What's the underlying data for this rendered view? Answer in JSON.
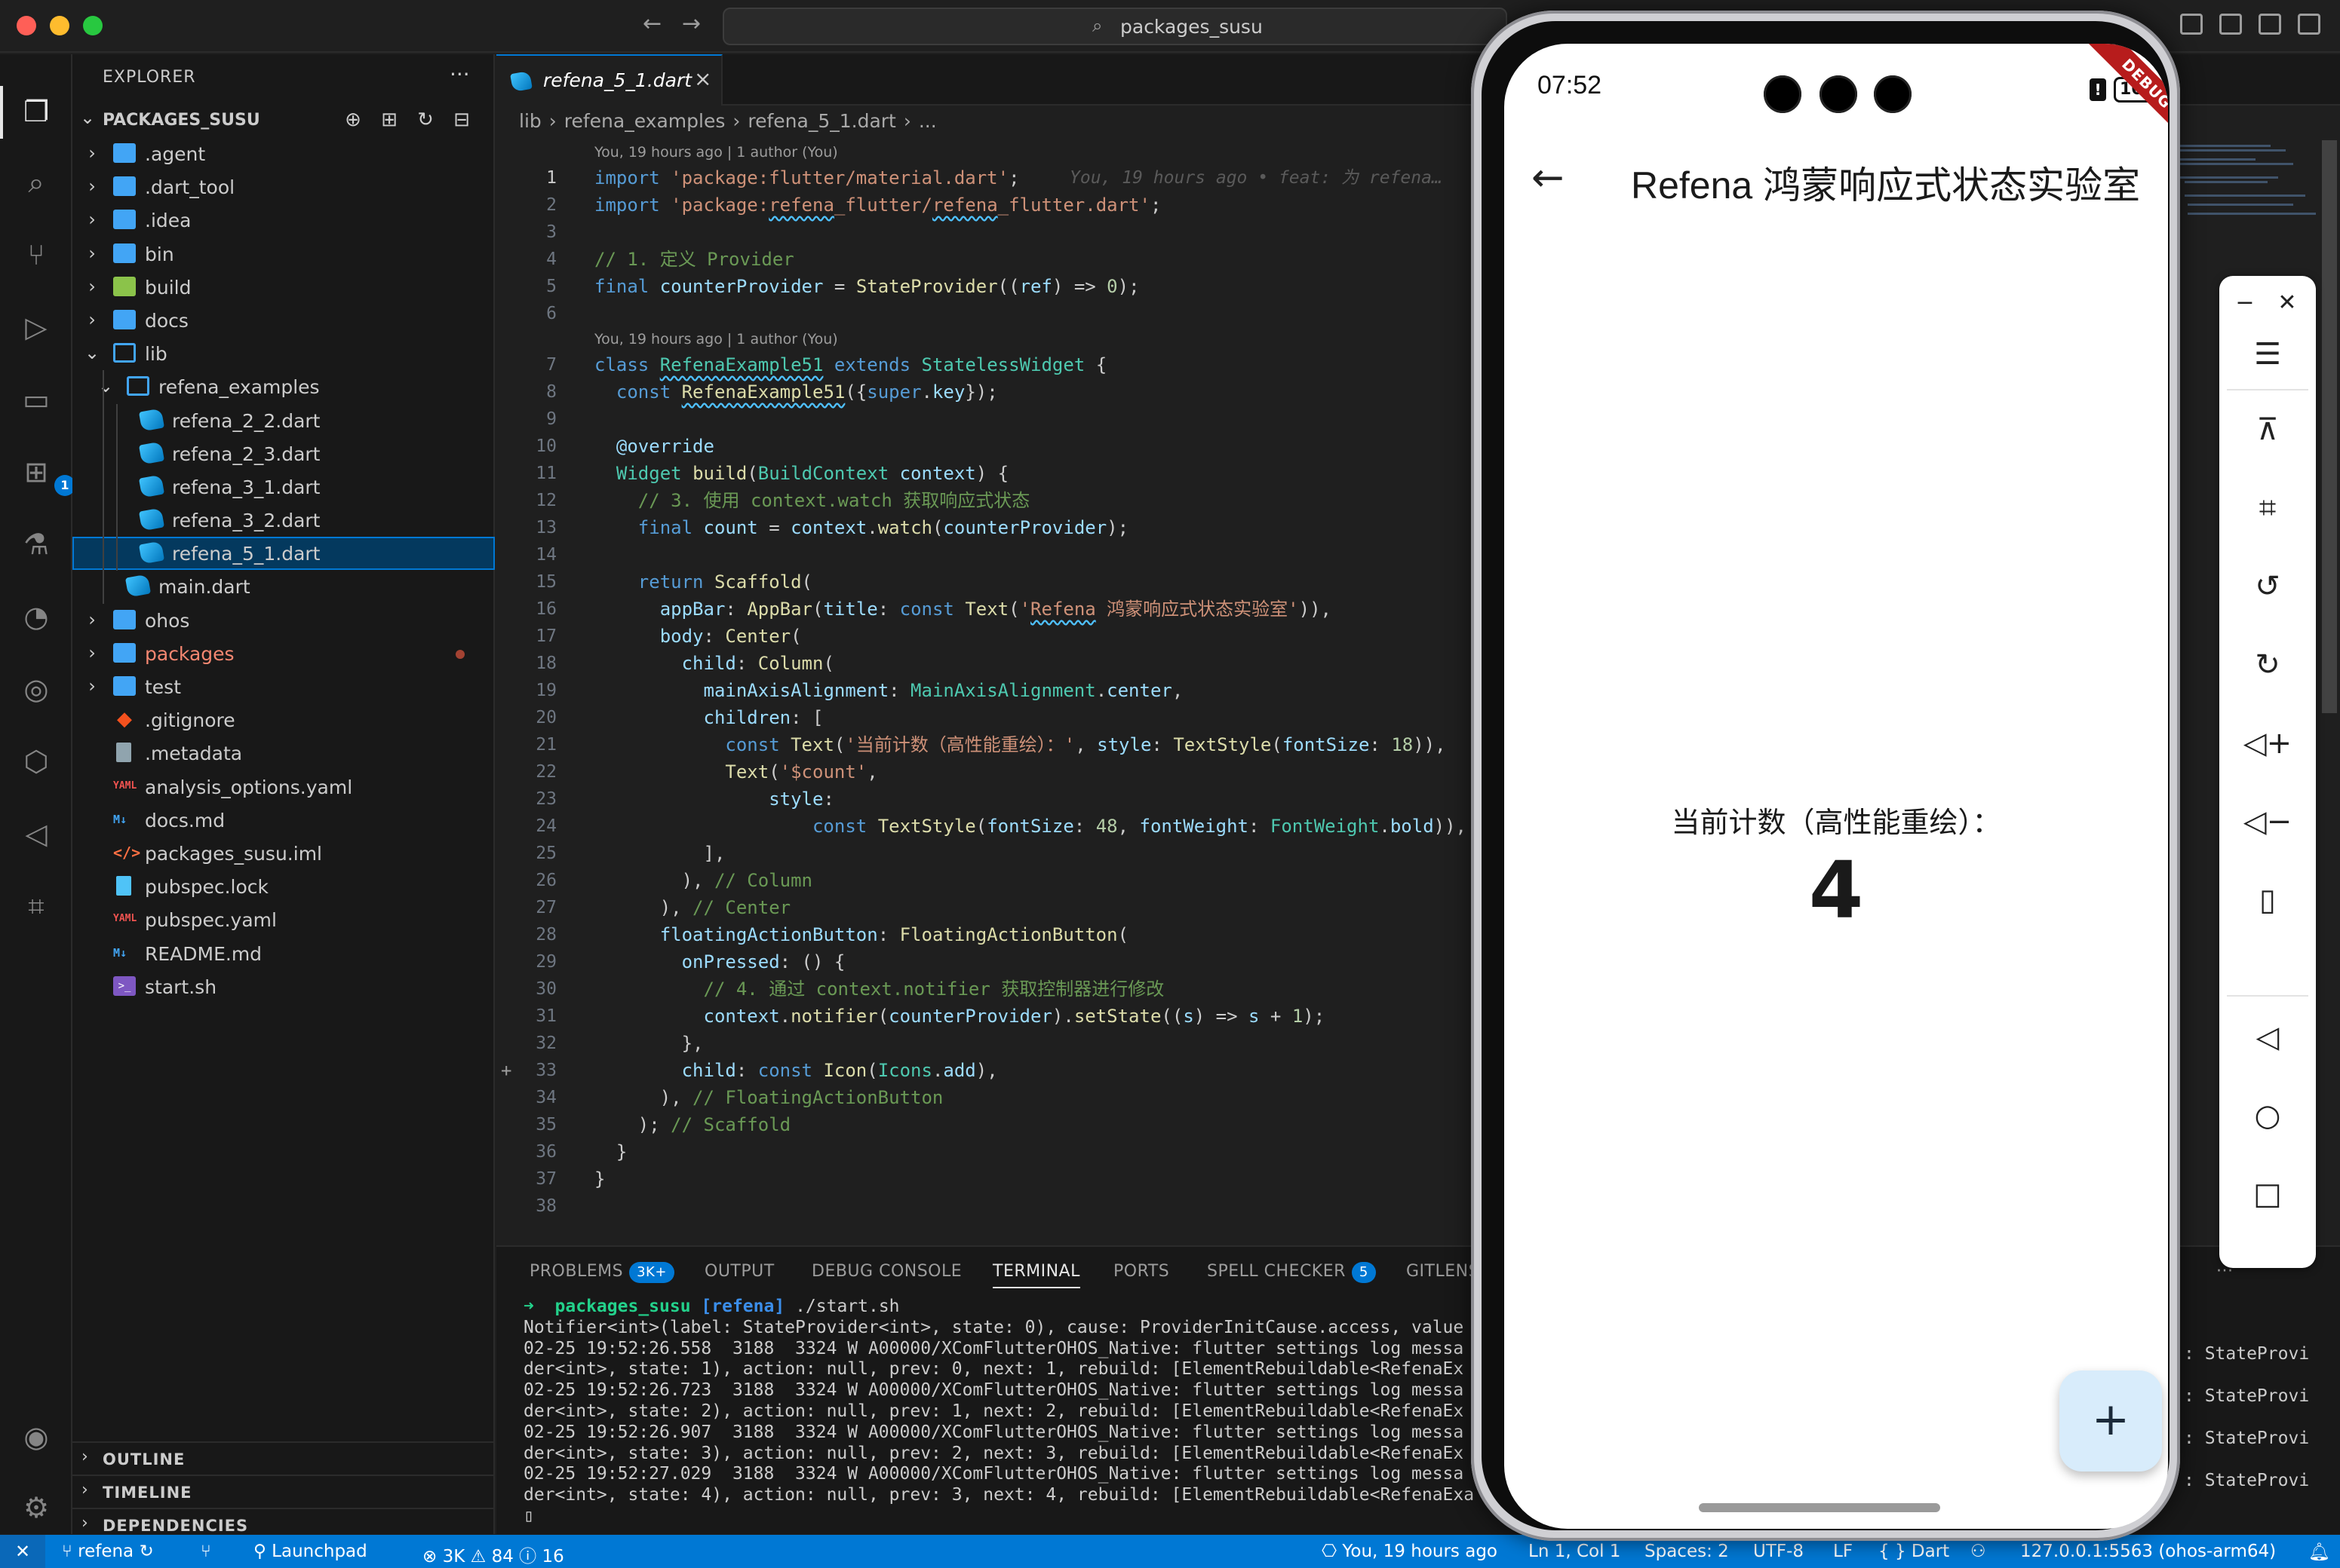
{
  "window": {
    "search_text": "packages_susu",
    "nav_back": "←",
    "nav_forward": "→"
  },
  "activity_bar": {
    "extensions_badge": "1"
  },
  "explorer": {
    "title": "EXPLORER",
    "more": "···",
    "root": "PACKAGES_SUSU",
    "items": [
      {
        "name": ".agent",
        "depth": 0,
        "type": "folder",
        "chev": "›"
      },
      {
        "name": ".dart_tool",
        "depth": 0,
        "type": "folder",
        "chev": "›"
      },
      {
        "name": ".idea",
        "depth": 0,
        "type": "folder",
        "chev": "›"
      },
      {
        "name": "bin",
        "depth": 0,
        "type": "folder",
        "chev": "›"
      },
      {
        "name": "build",
        "depth": 0,
        "type": "build",
        "chev": "›"
      },
      {
        "name": "docs",
        "depth": 0,
        "type": "folder",
        "chev": "›"
      },
      {
        "name": "lib",
        "depth": 0,
        "type": "folder-open",
        "chev": "⌄"
      },
      {
        "name": "refena_examples",
        "depth": 1,
        "type": "folder-open",
        "chev": "⌄"
      },
      {
        "name": "refena_2_2.dart",
        "depth": 2,
        "type": "dart",
        "chev": ""
      },
      {
        "name": "refena_2_3.dart",
        "depth": 2,
        "type": "dart",
        "chev": ""
      },
      {
        "name": "refena_3_1.dart",
        "depth": 2,
        "type": "dart",
        "chev": ""
      },
      {
        "name": "refena_3_2.dart",
        "depth": 2,
        "type": "dart",
        "chev": ""
      },
      {
        "name": "refena_5_1.dart",
        "depth": 2,
        "type": "dart",
        "chev": "",
        "selected": true
      },
      {
        "name": "main.dart",
        "depth": 1,
        "type": "dart",
        "chev": ""
      },
      {
        "name": "ohos",
        "depth": 0,
        "type": "folder",
        "chev": "›"
      },
      {
        "name": "packages",
        "depth": 0,
        "type": "folder",
        "chev": "›",
        "modified": true
      },
      {
        "name": "test",
        "depth": 0,
        "type": "folder",
        "chev": "›"
      },
      {
        "name": ".gitignore",
        "depth": 0,
        "type": "git",
        "chev": ""
      },
      {
        "name": ".metadata",
        "depth": 0,
        "type": "file",
        "chev": ""
      },
      {
        "name": "analysis_options.yaml",
        "depth": 0,
        "type": "yaml",
        "chev": ""
      },
      {
        "name": "docs.md",
        "depth": 0,
        "type": "md",
        "chev": ""
      },
      {
        "name": "packages_susu.iml",
        "depth": 0,
        "type": "code",
        "chev": ""
      },
      {
        "name": "pubspec.lock",
        "depth": 0,
        "type": "lock",
        "chev": ""
      },
      {
        "name": "pubspec.yaml",
        "depth": 0,
        "type": "yaml",
        "chev": ""
      },
      {
        "name": "README.md",
        "depth": 0,
        "type": "md",
        "chev": ""
      },
      {
        "name": "start.sh",
        "depth": 0,
        "type": "sh",
        "chev": ""
      }
    ],
    "sections": [
      "OUTLINE",
      "TIMELINE",
      "DEPENDENCIES"
    ]
  },
  "editor": {
    "tab_name": "refena_5_1.dart",
    "breadcrumb": [
      "lib",
      "›",
      "refena_examples",
      "›",
      "refena_5_1.dart",
      "›",
      "..."
    ],
    "blame_lens": "You, 19 hours ago | 1 author (You)",
    "inline_blame": "You, 19 hours ago • feat: 为 refena…",
    "lines": [
      {
        "n": "1",
        "lens_before": true,
        "html": "<span class='kw'>import</span> <span class='st'>'package:flutter/material.dart'</span>;"
      },
      {
        "n": "2",
        "html": "<span class='kw'>import</span> <span class='st'>'package:<span class='sq'>refena</span>_flutter/<span class='sq'>refena</span>_flutter.dart'</span>;"
      },
      {
        "n": "3",
        "html": ""
      },
      {
        "n": "4",
        "html": "<span class='cm'>// 1. 定义 Provider</span>"
      },
      {
        "n": "5",
        "html": "<span class='kw'>final</span> <span class='vr'>counterProvider</span> = <span class='fn'>StateProvider</span>((<span class='vr'>ref</span>) => <span class='nm'>0</span>);"
      },
      {
        "n": "6",
        "html": ""
      },
      {
        "n": "7",
        "lens_before": true,
        "html": "<span class='kw'>class</span> <span class='ty sq'>RefenaExample51</span> <span class='kw'>extends</span> <span class='ty'>StatelessWidget</span> {"
      },
      {
        "n": "8",
        "html": "  <span class='kw'>const</span> <span class='fn sq'>RefenaExample51</span>({<span class='kw'>super</span>.<span class='vr'>key</span>});"
      },
      {
        "n": "9",
        "html": ""
      },
      {
        "n": "10",
        "html": "  <span class='an'>@override</span>"
      },
      {
        "n": "11",
        "html": "  <span class='ty'>Widget</span> <span class='fn'>build</span>(<span class='ty'>BuildContext</span> <span class='vr'>context</span>) {"
      },
      {
        "n": "12",
        "html": "    <span class='cm'>// 3. 使用 context.watch 获取响应式状态</span>"
      },
      {
        "n": "13",
        "html": "    <span class='kw'>final</span> <span class='vr'>count</span> = <span class='vr'>context</span>.<span class='fn'>watch</span>(<span class='vr'>counterProvider</span>);"
      },
      {
        "n": "14",
        "html": ""
      },
      {
        "n": "15",
        "html": "    <span class='kw'>return</span> <span class='fn'>Scaffold</span>("
      },
      {
        "n": "16",
        "html": "      <span class='vr'>appBar</span>: <span class='fn'>AppBar</span>(<span class='vr'>title</span>: <span class='kw'>const</span> <span class='fn'>Text</span>(<span class='st'>'<span class='sq'>Refena</span> 鸿蒙响应式状态实验室'</span>)),"
      },
      {
        "n": "17",
        "html": "      <span class='vr'>body</span>: <span class='fn'>Center</span>("
      },
      {
        "n": "18",
        "html": "        <span class='vr'>child</span>: <span class='fn'>Column</span>("
      },
      {
        "n": "19",
        "html": "          <span class='vr'>mainAxisAlignment</span>: <span class='ty'>MainAxisAlignment</span>.<span class='vr'>center</span>,"
      },
      {
        "n": "20",
        "html": "          <span class='vr'>children</span>: ["
      },
      {
        "n": "21",
        "html": "            <span class='kw'>const</span> <span class='fn'>Text</span>(<span class='st'>'当前计数（高性能重绘）：'</span>, <span class='vr'>style</span>: <span class='fn'>TextStyle</span>(<span class='vr'>fontSize</span>: <span class='nm'>18</span>)),"
      },
      {
        "n": "22",
        "html": "            <span class='fn'>Text</span>(<span class='st'>'$count'</span>,"
      },
      {
        "n": "23",
        "html": "                <span class='vr'>style</span>:"
      },
      {
        "n": "24",
        "html": "                    <span class='kw'>const</span> <span class='fn'>TextStyle</span>(<span class='vr'>fontSize</span>: <span class='nm'>48</span>, <span class='vr'>fontWeight</span>: <span class='ty'>FontWeight</span>.<span class='vr'>bold</span>)),"
      },
      {
        "n": "25",
        "html": "          ],"
      },
      {
        "n": "26",
        "html": "        ), <span class='cm'>// Column</span>"
      },
      {
        "n": "27",
        "html": "      ), <span class='cm'>// Center</span>"
      },
      {
        "n": "28",
        "html": "      <span class='vr'>floatingActionButton</span>: <span class='fn'>FloatingActionButton</span>("
      },
      {
        "n": "29",
        "html": "        <span class='vr'>onPressed</span>: () {"
      },
      {
        "n": "30",
        "html": "          <span class='cm'>// 4. 通过 context.notifier 获取控制器进行修改</span>"
      },
      {
        "n": "31",
        "html": "          <span class='vr'>context</span>.<span class='fn'>notifier</span>(<span class='vr'>counterProvider</span>).<span class='fn'>setState</span>((<span class='vr'>s</span>) => <span class='vr'>s</span> + <span class='nm'>1</span>);"
      },
      {
        "n": "32",
        "html": "        },"
      },
      {
        "n": "33",
        "html": "        <span class='vr'>child</span>: <span class='kw'>const</span> <span class='fn'>Icon</span>(<span class='ty'>Icons</span>.<span class='vr'>add</span>),",
        "gutter": "+"
      },
      {
        "n": "34",
        "html": "      ), <span class='cm'>// FloatingActionButton</span>"
      },
      {
        "n": "35",
        "html": "    ); <span class='cm'>// Scaffold</span>"
      },
      {
        "n": "36",
        "html": "  }"
      },
      {
        "n": "37",
        "html": "}"
      },
      {
        "n": "38",
        "html": ""
      }
    ]
  },
  "panel": {
    "tabs": [
      {
        "label": "PROBLEMS",
        "badge": "3K+"
      },
      {
        "label": "OUTPUT"
      },
      {
        "label": "DEBUG CONSOLE"
      },
      {
        "label": "TERMINAL",
        "active": true
      },
      {
        "label": "PORTS"
      },
      {
        "label": "SPELL CHECKER",
        "badge": "5"
      },
      {
        "label": "GITLENS"
      }
    ],
    "more": "···",
    "prompt_dir": "packages_susu",
    "prompt_branch": "[refena]",
    "prompt_cmd": "./start.sh",
    "terminal_lines": [
      "Notifier<int>(label: StateProvider<int>, state: 0), cause: ProviderInitCause.access, value",
      "02-25 19:52:26.558  3188  3324 W A00000/XComFlutterOHOS_Native: flutter settings log messa",
      "der<int>, state: 1), action: null, prev: 0, next: 1, rebuild: [ElementRebuildable<RefenaEx",
      "02-25 19:52:26.723  3188  3324 W A00000/XComFlutterOHOS_Native: flutter settings log messa",
      "der<int>, state: 2), action: null, prev: 1, next: 2, rebuild: [ElementRebuildable<RefenaEx",
      "02-25 19:52:26.907  3188  3324 W A00000/XComFlutterOHOS_Native: flutter settings log messa",
      "der<int>, state: 3), action: null, prev: 2, next: 3, rebuild: [ElementRebuildable<RefenaEx",
      "02-25 19:52:27.029  3188  3324 W A00000/XComFlutterOHOS_Native: flutter settings log messa",
      "der<int>, state: 4), action: null, prev: 3, next: 4, rebuild: [ElementRebuildable<RefenaExa"
    ],
    "terminal_cursor": "▯",
    "right_fragments": [
      ": StateProvi",
      ": StateProvi",
      ": StateProvi",
      ": StateProvi"
    ]
  },
  "statusbar": {
    "remote": "✕",
    "branch": "refena",
    "launchpad": "Launchpad",
    "errors": "3K",
    "warnings": "84",
    "infos": "16",
    "blame": "You, 19 hours ago",
    "position": "Ln 1, Col 1",
    "spaces": "Spaces: 2",
    "encoding": "UTF-8",
    "eol": "LF",
    "language": "Dart",
    "device": "127.0.0.1:5563 (ohos-arm64)"
  },
  "phone": {
    "time": "07:52",
    "battery": "100",
    "debug_banner": "DEBUG",
    "app_title": "Refena 鸿蒙响应式状态实验室",
    "count_label": "当前计数（高性能重绘）：",
    "count_value": "4",
    "fab_label": "+",
    "back": "←"
  },
  "emulator_toolbar": {
    "minimize": "−",
    "close": "✕",
    "menu": "☰",
    "buttons": [
      "pin-off-icon",
      "crop-icon",
      "rotate-left-icon",
      "rotate-right-icon",
      "volume-up-icon",
      "volume-down-icon",
      "shake-icon",
      "back-nav-icon",
      "home-nav-icon",
      "recents-nav-icon"
    ]
  },
  "colors": {
    "accent": "#0078d4",
    "editor_bg": "#1f1f1f",
    "sidebar_bg": "#181818",
    "statusbar_bg": "#0078d4"
  }
}
